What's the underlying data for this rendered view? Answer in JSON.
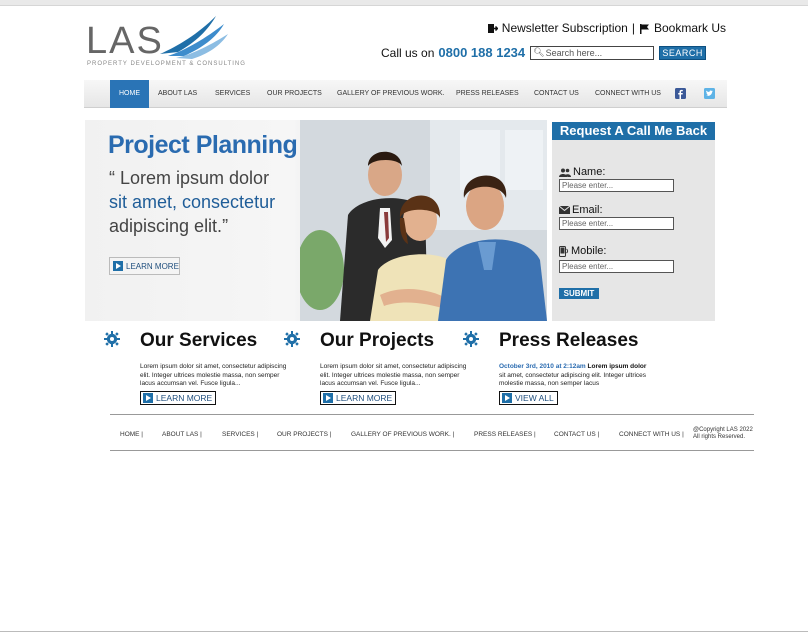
{
  "brand": {
    "name": "LAS",
    "tagline": "PROPERTY DEVELOPMENT & CONSULTING"
  },
  "toplinks": {
    "newsletter": "Newsletter Subscription",
    "separator": "|",
    "bookmark": "Bookmark Us"
  },
  "contact": {
    "call_label": "Call us on",
    "phone": "0800 188 1234"
  },
  "search": {
    "placeholder": "Search here...",
    "button": "SEARCH"
  },
  "nav": {
    "items": [
      {
        "label": "HOME",
        "active": true
      },
      {
        "label": "ABOUT LAS"
      },
      {
        "label": "SERVICES"
      },
      {
        "label": "OUR PROJECTS"
      },
      {
        "label": "GALLERY OF PREVIOUS WORK."
      },
      {
        "label": "PRESS RELEASES"
      },
      {
        "label": "CONTACT US"
      },
      {
        "label": "CONNECT WITH US"
      }
    ],
    "social": [
      "facebook-icon",
      "twitter-icon"
    ]
  },
  "hero": {
    "title": "Project Planning",
    "quote_line1": "“ Lorem ipsum dolor",
    "quote_line2": "sit amet, consectetur",
    "quote_line3": "adipiscing elit.”",
    "button": "LEARN MORE"
  },
  "callback": {
    "title": "Request A Call Me Back",
    "name_label": "Name:",
    "email_label": "Email:",
    "mobile_label": "Mobile:",
    "placeholder": "Please enter...",
    "submit": "SUBMIT"
  },
  "sections": {
    "services": {
      "title": "Our Services",
      "text": "Lorem ipsum dolor sit amet, consectetur adipiscing elit. Integer ultrices molestie massa, non semper lacus accumsan vel. Fusce ligula...",
      "button": "LEARN MORE"
    },
    "projects": {
      "title": "Our Projects",
      "text": "Lorem ipsum dolor sit amet, consectetur adipiscing elit. Integer ultrices molestie massa, non semper lacus accumsan vel. Fusce ligula...",
      "button": "LEARN MORE"
    },
    "press": {
      "title": "Press Releases",
      "date": "October 3rd, 2010 at 2:12am",
      "text_bold": "Lorem ipsum dolor",
      "text": " sit amet, consectetur adipiscing elit. Integer ultrices molestie massa, non semper lacus",
      "button": "VIEW ALL"
    }
  },
  "footer": {
    "links": [
      "HOME |",
      "ABOUT LAS |",
      "SERVICES |",
      "OUR PROJECTS |",
      "GALLERY OF PREVIOUS WORK. |",
      "PRESS RELEASES |",
      "CONTACT US |",
      "CONNECT WITH US |"
    ],
    "copyright_1": "@Copyright LAS 2022",
    "copyright_2": "All rights Reserved."
  },
  "colors": {
    "accent": "#1f6fa8",
    "nav_active": "#2a74b6",
    "heading_blue": "#2a6bb0"
  }
}
